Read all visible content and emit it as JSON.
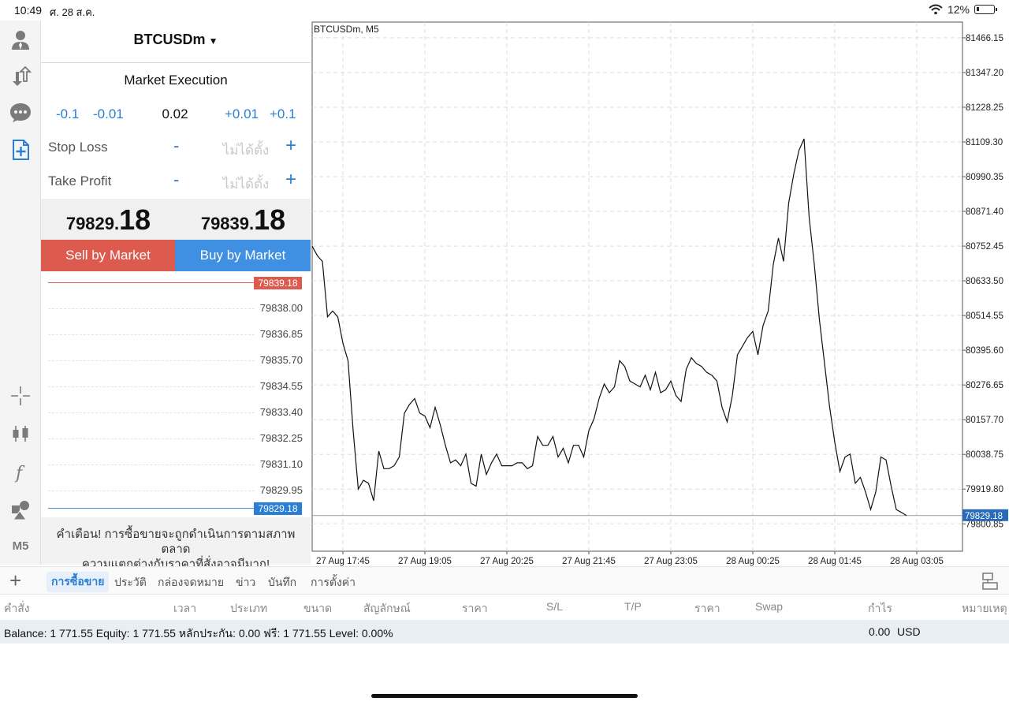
{
  "status_bar": {
    "time": "10:49",
    "date": "ศ. 28 ส.ค.",
    "battery": "12%"
  },
  "left_toolbar": {
    "top_icons": [
      "account-icon",
      "trade-arrows-icon",
      "chat-icon",
      "new-order-icon"
    ],
    "bottom_icons": [
      "crosshair-icon",
      "candlestick-icon",
      "indicator-f-icon",
      "objects-icon"
    ],
    "timeframe": "M5"
  },
  "order_panel": {
    "symbol": "BTCUSDm",
    "symbol_caret": "▼",
    "execution": "Market Execution",
    "volume": {
      "minus_large": "-0.1",
      "minus_small": "-0.01",
      "value": "0.02",
      "plus_small": "+0.01",
      "plus_large": "+0.1"
    },
    "stop_loss": {
      "label": "Stop Loss",
      "minus": "-",
      "value": "ไม่ได้ตั้ง",
      "plus": "+"
    },
    "take_profit": {
      "label": "Take Profit",
      "minus": "-",
      "value": "ไม่ได้ตั้ง",
      "plus": "+"
    },
    "bid_price": {
      "main": "79829.",
      "big": "18"
    },
    "ask_price": {
      "main": "79839.",
      "big": "18"
    },
    "sell_label": "Sell by Market",
    "buy_label": "Buy by Market",
    "tick_chart": {
      "ask_tag": "79839.18",
      "bid_tag": "79829.18",
      "levels": [
        "79838.00",
        "79836.85",
        "79835.70",
        "79834.55",
        "79833.40",
        "79832.25",
        "79831.10",
        "79829.95"
      ]
    },
    "warning_line1": "คำเตือน! การซื้อขายจะถูกดำเนินการตามสภาพตลาด",
    "warning_line2": "ความแตกต่างกับราคาที่สั่งอาจมีมาก!"
  },
  "chart_data": {
    "type": "line",
    "title": "BTCUSDm, M5",
    "y_ticks": [
      81466.15,
      81347.2,
      81228.25,
      81109.3,
      80990.35,
      80871.4,
      80752.45,
      80633.5,
      80514.55,
      80395.6,
      80276.65,
      80157.7,
      80038.75,
      79919.8,
      79800.85
    ],
    "y_tick_labels": [
      "81466.15",
      "81347.20",
      "81228.25",
      "81109.30",
      "80990.35",
      "80871.40",
      "80752.45",
      "80633.50",
      "80514.55",
      "80395.60",
      "80276.65",
      "80157.70",
      "80038.75",
      "79919.80",
      "79800.85"
    ],
    "ylim": [
      79707,
      81520
    ],
    "x_tick_labels": [
      "27 Aug 17:45",
      "27 Aug 19:05",
      "27 Aug 20:25",
      "27 Aug 21:45",
      "27 Aug 23:05",
      "28 Aug 00:25",
      "28 Aug 01:45",
      "28 Aug 03:05"
    ],
    "x_tick_index": [
      6,
      22,
      38,
      54,
      70,
      86,
      102,
      118
    ],
    "current_price": 79829.18,
    "current_price_label": "79829.18",
    "grid": true,
    "series": [
      {
        "values": [
          80752,
          80720,
          80700,
          80510,
          80530,
          80510,
          80420,
          80360,
          80120,
          79920,
          79950,
          79940,
          79880,
          80050,
          79990,
          79990,
          80000,
          80030,
          80180,
          80210,
          80230,
          80180,
          80170,
          80130,
          80200,
          80140,
          80070,
          80010,
          80020,
          80000,
          80040,
          79940,
          79930,
          80040,
          79970,
          80010,
          80040,
          80000,
          80000,
          80000,
          80010,
          80010,
          79990,
          80000,
          80100,
          80070,
          80070,
          80100,
          80030,
          80060,
          80010,
          80070,
          80070,
          80030,
          80120,
          80160,
          80230,
          80280,
          80250,
          80270,
          80360,
          80340,
          80290,
          80280,
          80270,
          80310,
          80260,
          80320,
          80250,
          80260,
          80290,
          80240,
          80220,
          80330,
          80370,
          80350,
          80340,
          80320,
          80310,
          80290,
          80200,
          80150,
          80240,
          80380,
          80410,
          80440,
          80460,
          80380,
          80480,
          80530,
          80690,
          80780,
          80700,
          80900,
          81000,
          81080,
          81120,
          80850,
          80690,
          80500,
          80350,
          80200,
          80080,
          79980,
          80030,
          80040,
          79940,
          79960,
          79910,
          79850,
          79910,
          80030,
          80020,
          79930,
          79850,
          79840,
          79829
        ]
      }
    ]
  },
  "bottom_tabs": {
    "tabs": [
      "การซื้อขาย",
      "ประวัติ",
      "กล่องจดหมาย",
      "ข่าว",
      "บันทึก",
      "การตั้งค่า"
    ],
    "active": 0
  },
  "table_columns": [
    "คำสั่ง",
    "เวลา",
    "ประเภท",
    "ขนาด",
    "สัญลักษณ์",
    "ราคา",
    "S/L",
    "T/P",
    "ราคา",
    "Swap",
    "กำไร",
    "หมายเหตุ"
  ],
  "balance_row": {
    "text": "Balance: 1 771.55 Equity: 1 771.55 หลักประกัน: 0.00 ฟรี: 1 771.55 Level: 0.00%",
    "profit": "0.00",
    "currency": "USD"
  }
}
